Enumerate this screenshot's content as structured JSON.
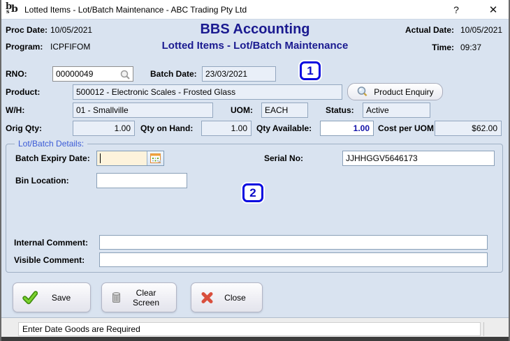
{
  "window": {
    "title": "Lotted Items - Lot/Batch Maintenance - ABC Trading Pty Ltd",
    "help_button": "?",
    "close_button": "✕",
    "logo": {
      "b1": "b",
      "s": "s",
      "b2": "b"
    }
  },
  "header": {
    "proc_date_label": "Proc Date:",
    "proc_date": "10/05/2021",
    "program_label": "Program:",
    "program": "ICPFIFOM",
    "app_title": "BBS Accounting",
    "screen_title": "Lotted Items - Lot/Batch Maintenance",
    "actual_date_label": "Actual Date:",
    "actual_date": "10/05/2021",
    "time_label": "Time:",
    "time": "09:37"
  },
  "fields": {
    "rno_label": "RNO:",
    "rno": "00000049",
    "batch_date_label": "Batch Date:",
    "batch_date": "23/03/2021",
    "product_label": "Product:",
    "product": "500012 - Electronic Scales - Frosted Glass",
    "product_enquiry_button": "Product Enquiry",
    "wh_label": "W/H:",
    "wh": "01 - Smallville",
    "uom_label": "UOM:",
    "uom": "EACH",
    "status_label": "Status:",
    "status": "Active",
    "orig_qty_label": "Orig Qty:",
    "orig_qty": "1.00",
    "qty_on_hand_label": "Qty on Hand:",
    "qty_on_hand": "1.00",
    "qty_available_label": "Qty Available:",
    "qty_available": "1.00",
    "cost_per_uom_label": "Cost per UOM:",
    "cost_per_uom": "$62.00"
  },
  "lot": {
    "group_title": "Lot/Batch Details:",
    "batch_expiry_label": "Batch Expiry Date:",
    "batch_expiry_value": "",
    "serial_no_label": "Serial No:",
    "serial_no": "JJHHGGV5646173",
    "bin_location_label": "Bin Location:",
    "bin_location": "",
    "internal_comment_label": "Internal Comment:",
    "internal_comment": "",
    "visible_comment_label": "Visible Comment:",
    "visible_comment": ""
  },
  "annotations": {
    "marker_1": "1",
    "marker_2": "2"
  },
  "buttons": {
    "save": "Save",
    "clear_screen": "Clear Screen",
    "close": "Close"
  },
  "status_bar": {
    "message": "Enter Date Goods are Required"
  },
  "icons": {
    "app": "bbs-logo",
    "rno_lookup": "search-icon",
    "product_enquiry": "search-icon",
    "batch_expiry": "calendar-icon",
    "save": "green-check-icon",
    "clear_screen": "eraser-icon",
    "close": "red-x-icon"
  },
  "colors": {
    "accent_navy": "#1a1a90",
    "annotation_blue": "#0a0ae0",
    "window_bg": "#d9e3f0",
    "field_bg": "#e9eff8",
    "expiry_field_bg": "#fdf3dc",
    "group_label_blue": "#3b5bd6",
    "save_green": "#58b814",
    "close_red": "#d94f3d"
  }
}
